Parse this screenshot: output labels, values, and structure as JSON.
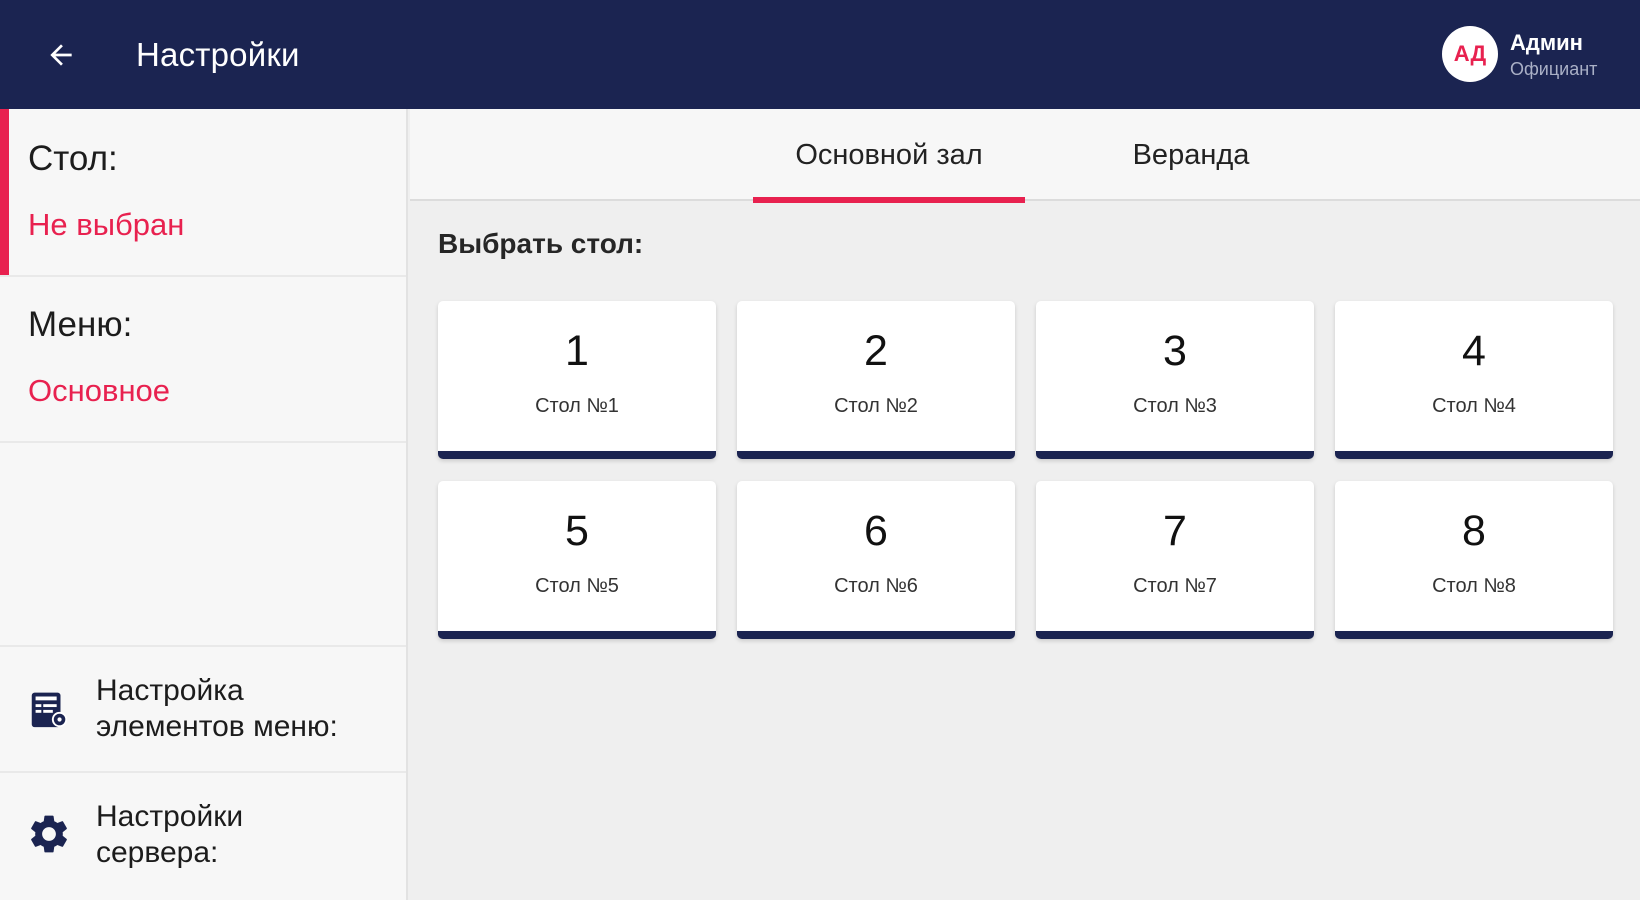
{
  "header": {
    "title": "Настройки",
    "back_icon": "arrow-left-icon",
    "user": {
      "initials": "АД",
      "name": "Админ",
      "role": "Официант"
    }
  },
  "sidebar": {
    "table": {
      "label": "Стол:",
      "value": "Не выбран"
    },
    "menu": {
      "label": "Меню:",
      "value": "Основное"
    },
    "menu_items_settings": {
      "label_line1": "Настройка",
      "label_line2": "элементов меню:",
      "icon": "menu-settings-icon"
    },
    "server_settings": {
      "label_line1": "Настройки",
      "label_line2": "сервера:",
      "icon": "gear-icon"
    }
  },
  "tabs": [
    {
      "label": "Основной зал",
      "active": true
    },
    {
      "label": "Веранда",
      "active": false
    }
  ],
  "main": {
    "section_title": "Выбрать стол:",
    "tables": [
      {
        "number": "1",
        "name": "Стол №1"
      },
      {
        "number": "2",
        "name": "Стол №2"
      },
      {
        "number": "3",
        "name": "Стол №3"
      },
      {
        "number": "4",
        "name": "Стол №4"
      },
      {
        "number": "5",
        "name": "Стол №5"
      },
      {
        "number": "6",
        "name": "Стол №6"
      },
      {
        "number": "7",
        "name": "Стол №7"
      },
      {
        "number": "8",
        "name": "Стол №8"
      }
    ]
  },
  "colors": {
    "primary": "#1b2451",
    "accent": "#e8214f",
    "background": "#efefef"
  }
}
